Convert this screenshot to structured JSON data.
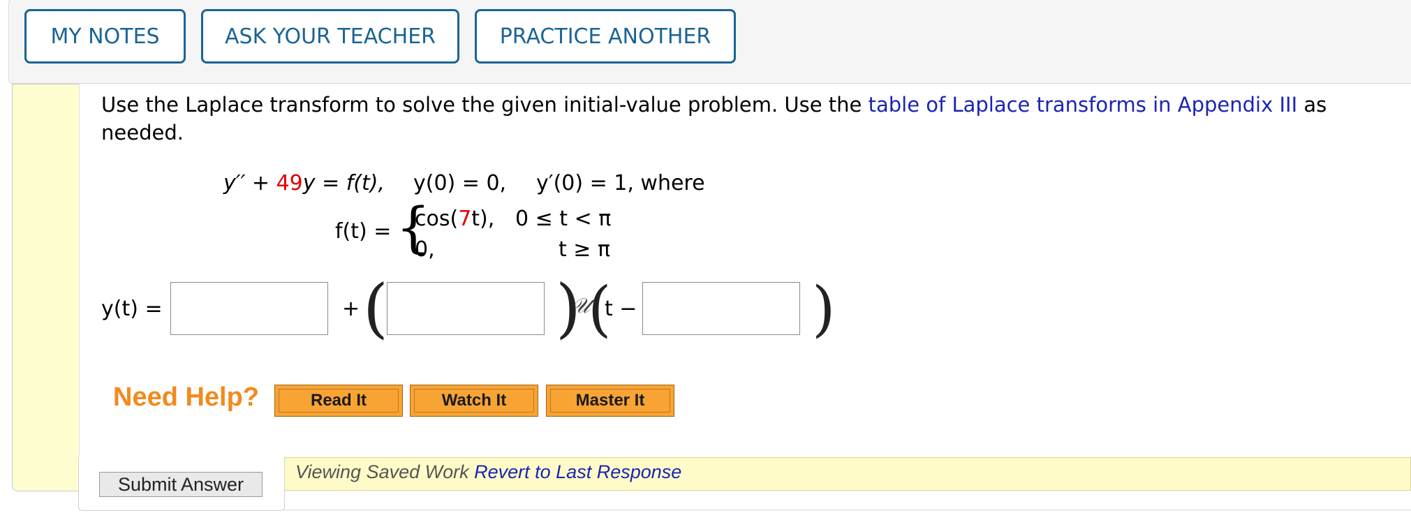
{
  "toolbar": {
    "my_notes": "MY NOTES",
    "ask_teacher": "ASK YOUR TEACHER",
    "practice_another": "PRACTICE ANOTHER"
  },
  "question": {
    "text_before_link": "Use the Laplace transform to solve the given initial-value problem. Use the ",
    "link_text": "table of Laplace transforms in Appendix III",
    "text_after_link": " as needed.",
    "equation_line": {
      "lhs_a": "y′′ + ",
      "coef": "49",
      "lhs_b": "y = f(t),",
      "ic1": "y(0) = 0,",
      "ic2": "y′(0) = 1, where"
    },
    "piecewise": {
      "lhs": "f(t) =",
      "case1_a": "cos(",
      "case1_coef": "7",
      "case1_b": "t),",
      "case1_cond": "0 ≤ t < π",
      "case2": "0,",
      "case2_cond": "t ≥ π"
    }
  },
  "answer": {
    "label": "y(t) =",
    "plus": "+",
    "step_symbol": "𝒰",
    "t_minus": "t −",
    "field1_value": "",
    "field2_value": "",
    "field3_value": ""
  },
  "help": {
    "label": "Need Help?",
    "read_it": "Read It",
    "watch_it": "Watch It",
    "master_it": "Master It"
  },
  "footer": {
    "submit": "Submit Answer",
    "viewing_saved": "Viewing Saved Work ",
    "revert": "Revert to Last Response"
  },
  "colors": {
    "accent_blue": "#1a6496",
    "link_blue": "#1a24b4",
    "highlight_red": "#e00000",
    "help_orange": "#f28a1e",
    "help_button": "#f7a434",
    "panel_yellow": "#fefdd0"
  }
}
